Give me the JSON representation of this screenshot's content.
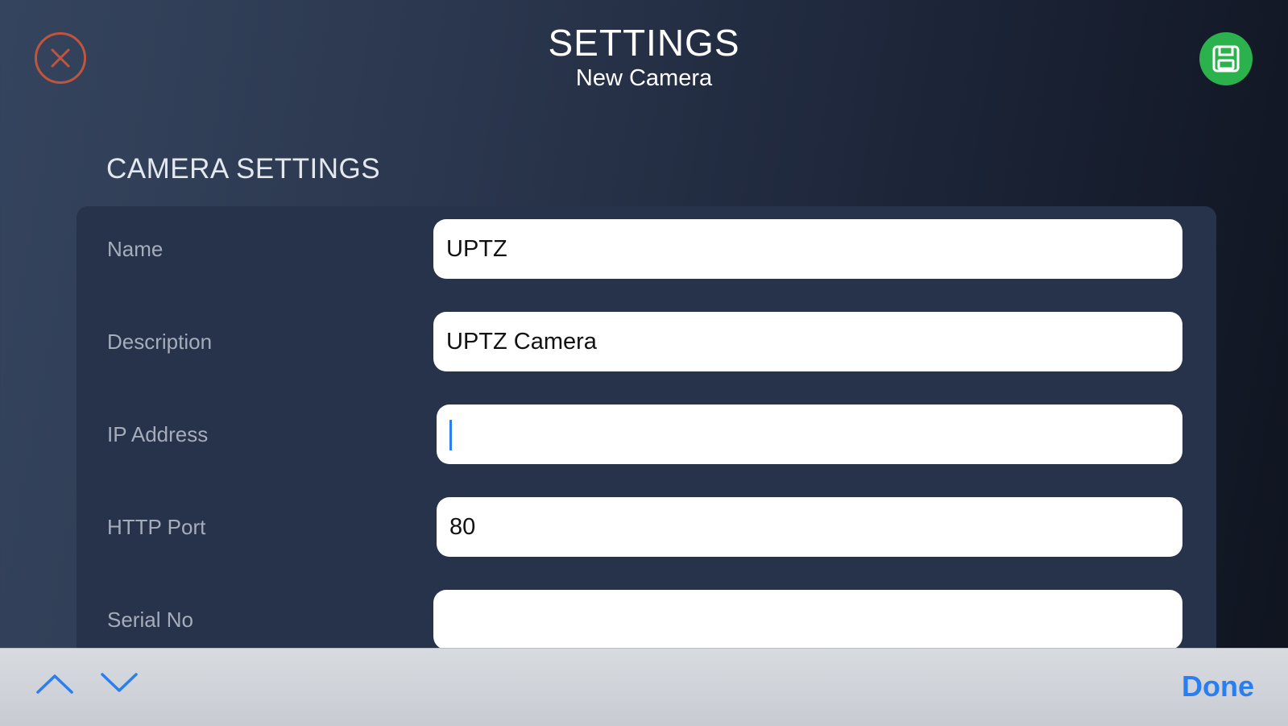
{
  "header": {
    "title": "SETTINGS",
    "subtitle": "New Camera",
    "close_icon": "close-circle-icon",
    "save_icon": "floppy-disk-icon",
    "close_color": "#c0553d",
    "save_color": "#2bb24c"
  },
  "section": {
    "title": "CAMERA SETTINGS"
  },
  "fields": [
    {
      "label": "Name",
      "value": "UPTZ"
    },
    {
      "label": "Description",
      "value": "UPTZ Camera"
    },
    {
      "label": "IP Address",
      "value": ""
    },
    {
      "label": "HTTP Port",
      "value": "80"
    },
    {
      "label": "Serial No",
      "value": ""
    }
  ],
  "keyboard_toolbar": {
    "up_icon": "chevron-up-icon",
    "down_icon": "chevron-down-icon",
    "done_label": "Done",
    "accent": "#2a7ef0"
  }
}
